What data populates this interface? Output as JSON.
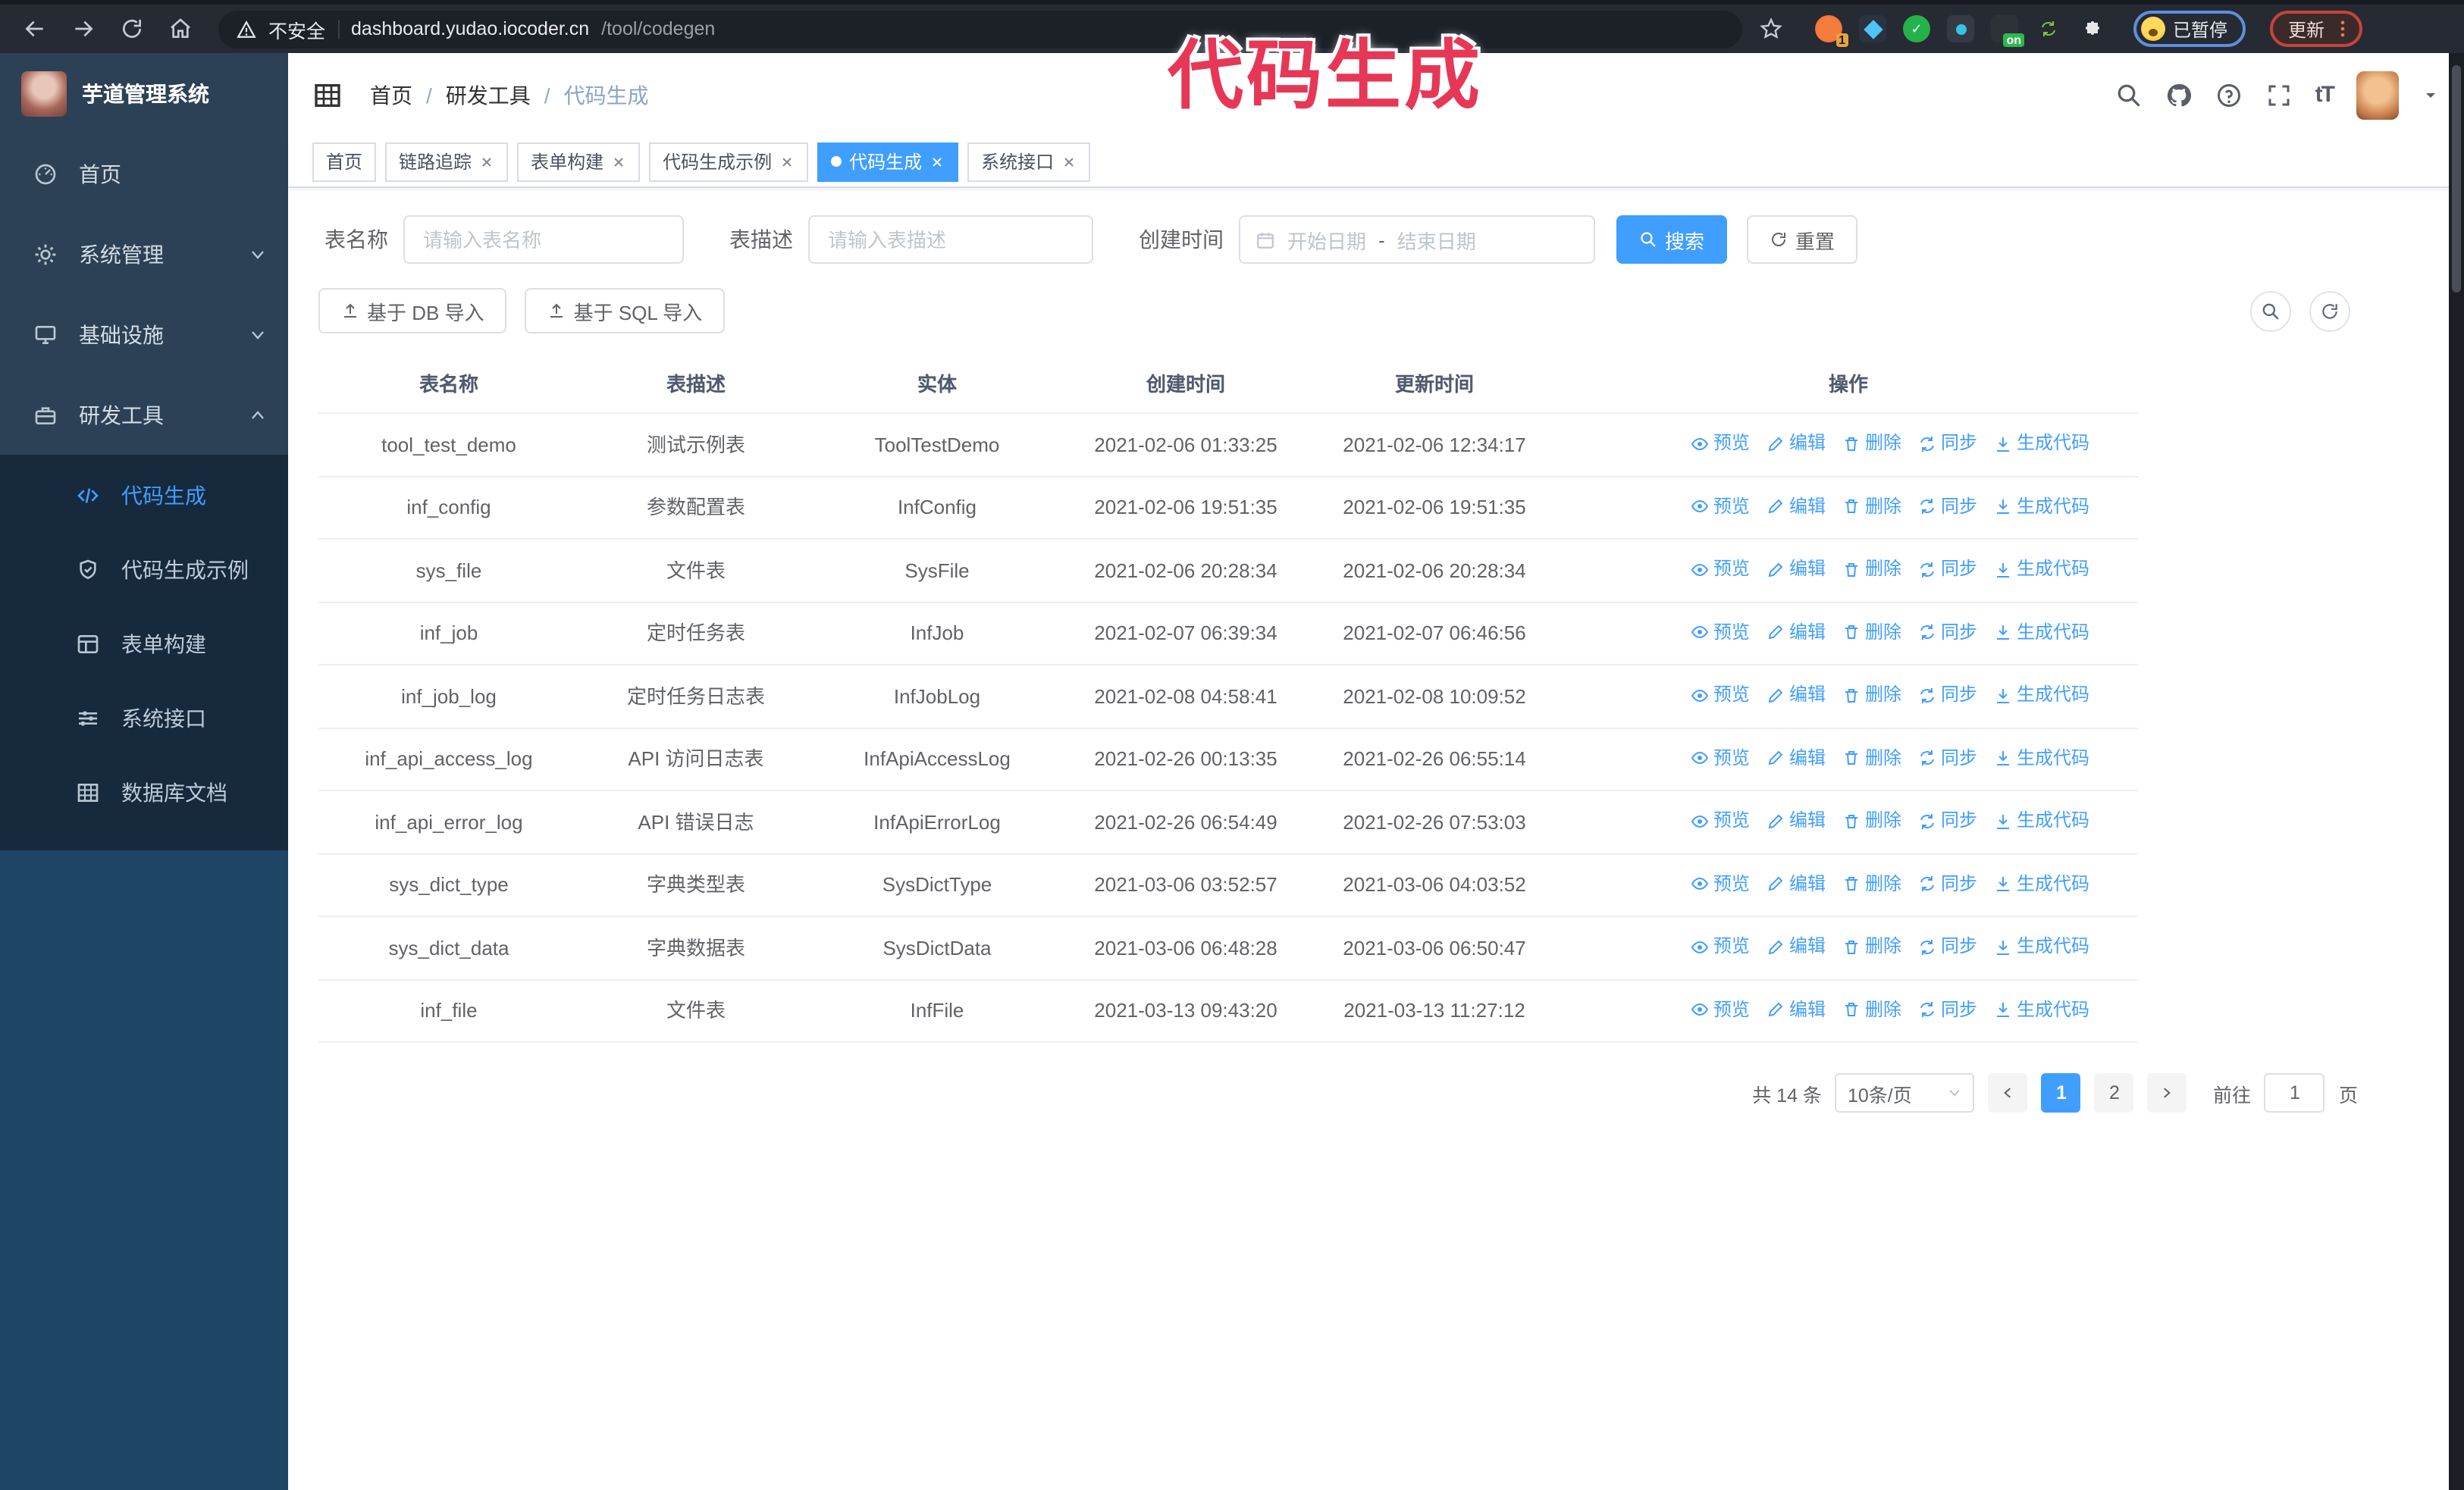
{
  "colors": {
    "accent": "#409eff",
    "annotation": "#e73757"
  },
  "annotation": {
    "text": "代码生成"
  },
  "browser": {
    "security_label": "不安全",
    "url_host": "dashboard.yudao.iocoder.cn",
    "url_path": "/tool/codegen",
    "extension_badge_count": "1",
    "extension_badge_on": "on",
    "paused_label": "已暂停",
    "update_label": "更新"
  },
  "sidebar": {
    "logo_title": "芋道管理系统",
    "items": [
      {
        "label": "首页",
        "icon": "dashboard"
      },
      {
        "label": "系统管理",
        "icon": "gear",
        "chevron": "down"
      },
      {
        "label": "基础设施",
        "icon": "monitor",
        "chevron": "down"
      },
      {
        "label": "研发工具",
        "icon": "toolbox",
        "chevron": "up"
      }
    ],
    "subitems": [
      {
        "label": "代码生成",
        "icon": "code",
        "active": true
      },
      {
        "label": "代码生成示例",
        "icon": "shield"
      },
      {
        "label": "表单构建",
        "icon": "form"
      },
      {
        "label": "系统接口",
        "icon": "sliders"
      },
      {
        "label": "数据库文档",
        "icon": "dbdoc"
      }
    ]
  },
  "header": {
    "breadcrumb": [
      "首页",
      "研发工具",
      "代码生成"
    ]
  },
  "tabs": [
    {
      "label": "首页",
      "closable": false,
      "active": false
    },
    {
      "label": "链路追踪",
      "closable": true,
      "active": false
    },
    {
      "label": "表单构建",
      "closable": true,
      "active": false
    },
    {
      "label": "代码生成示例",
      "closable": true,
      "active": false
    },
    {
      "label": "代码生成",
      "closable": true,
      "active": true
    },
    {
      "label": "系统接口",
      "closable": true,
      "active": false
    }
  ],
  "filters": {
    "name_label": "表名称",
    "name_placeholder": "请输入表名称",
    "desc_label": "表描述",
    "desc_placeholder": "请输入表描述",
    "time_label": "创建时间",
    "start_placeholder": "开始日期",
    "range_separator": "-",
    "end_placeholder": "结束日期",
    "search_label": "搜索",
    "reset_label": "重置"
  },
  "toolbar": {
    "import_db_label": "基于 DB 导入",
    "import_sql_label": "基于 SQL 导入"
  },
  "table": {
    "headers": [
      "表名称",
      "表描述",
      "实体",
      "创建时间",
      "更新时间",
      "操作"
    ],
    "actions": [
      "预览",
      "编辑",
      "删除",
      "同步",
      "生成代码"
    ],
    "rows": [
      {
        "name": "tool_test_demo",
        "desc": "测试示例表",
        "entity": "ToolTestDemo",
        "created": "2021-02-06 01:33:25",
        "updated": "2021-02-06 12:34:17"
      },
      {
        "name": "inf_config",
        "desc": "参数配置表",
        "entity": "InfConfig",
        "created": "2021-02-06 19:51:35",
        "updated": "2021-02-06 19:51:35"
      },
      {
        "name": "sys_file",
        "desc": "文件表",
        "entity": "SysFile",
        "created": "2021-02-06 20:28:34",
        "updated": "2021-02-06 20:28:34"
      },
      {
        "name": "inf_job",
        "desc": "定时任务表",
        "entity": "InfJob",
        "created": "2021-02-07 06:39:34",
        "updated": "2021-02-07 06:46:56"
      },
      {
        "name": "inf_job_log",
        "desc": "定时任务日志表",
        "entity": "InfJobLog",
        "created": "2021-02-08 04:58:41",
        "updated": "2021-02-08 10:09:52"
      },
      {
        "name": "inf_api_access_log",
        "desc": "API 访问日志表",
        "entity": "InfApiAccessLog",
        "created": "2021-02-26 00:13:35",
        "updated": "2021-02-26 06:55:14"
      },
      {
        "name": "inf_api_error_log",
        "desc": "API 错误日志",
        "entity": "InfApiErrorLog",
        "created": "2021-02-26 06:54:49",
        "updated": "2021-02-26 07:53:03"
      },
      {
        "name": "sys_dict_type",
        "desc": "字典类型表",
        "entity": "SysDictType",
        "created": "2021-03-06 03:52:57",
        "updated": "2021-03-06 04:03:52"
      },
      {
        "name": "sys_dict_data",
        "desc": "字典数据表",
        "entity": "SysDictData",
        "created": "2021-03-06 06:48:28",
        "updated": "2021-03-06 06:50:47"
      },
      {
        "name": "inf_file",
        "desc": "文件表",
        "entity": "InfFile",
        "created": "2021-03-13 09:43:20",
        "updated": "2021-03-13 11:27:12"
      }
    ]
  },
  "pagination": {
    "total_label": "共 14 条",
    "page_size_label": "10条/页",
    "pages": [
      "1",
      "2"
    ],
    "active_page": "1",
    "goto_label": "前往",
    "goto_value": "1",
    "page_suffix_label": "页"
  }
}
